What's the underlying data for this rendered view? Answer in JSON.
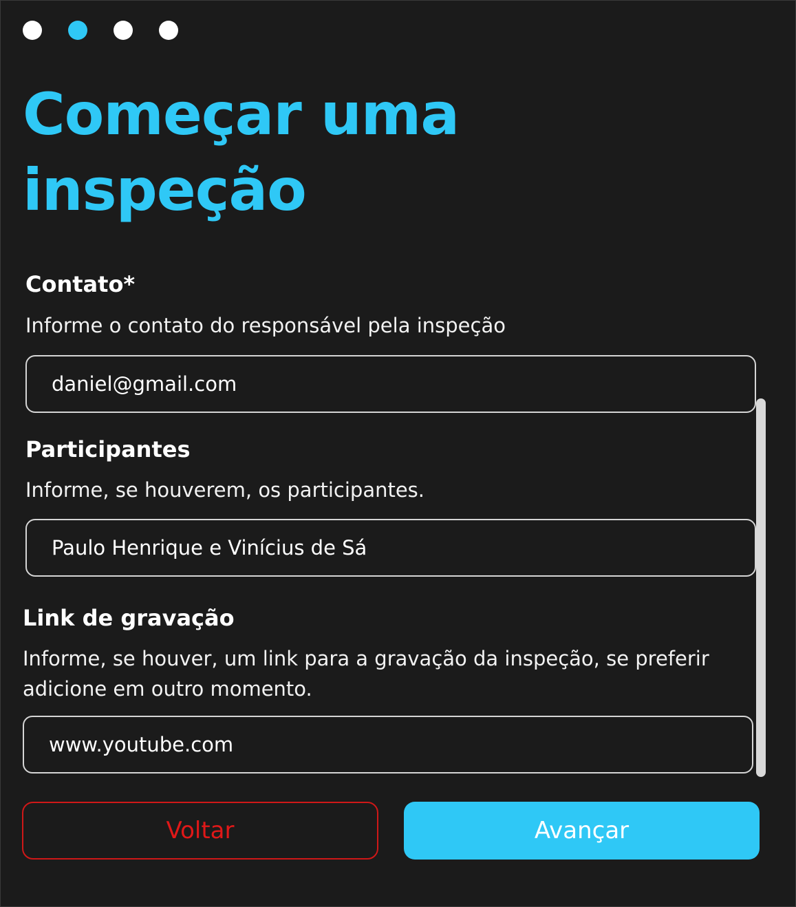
{
  "stepper": {
    "total_steps": 4,
    "active_step": 2,
    "active_color": "#2fc8f6",
    "inactive_color": "#ffffff"
  },
  "title": "Começar uma inspeção",
  "form": {
    "contact": {
      "label": "Contato*",
      "help": "Informe o contato do responsável pela inspeção",
      "value": "daniel@gmail.com"
    },
    "participants": {
      "label": "Participantes",
      "help": "Informe, se houverem, os participantes.",
      "value": "Paulo Henrique e Vinícius de Sá"
    },
    "recording_link": {
      "label": "Link de gravação",
      "help": "Informe, se houver, um link para a gravação da inspeção, se preferir adicione em outro momento.",
      "value": "www.youtube.com"
    }
  },
  "buttons": {
    "back": "Voltar",
    "next": "Avançar"
  },
  "colors": {
    "background": "#1b1b1b",
    "accent": "#2fc8f6",
    "danger": "#e01818"
  }
}
